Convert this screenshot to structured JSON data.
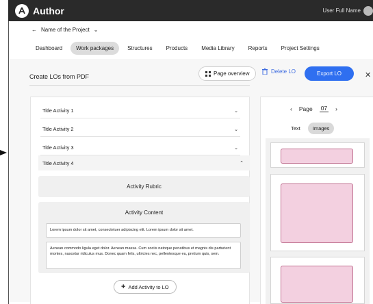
{
  "app": {
    "title": "Author",
    "user_name": "User Full Name"
  },
  "project": {
    "name": "Name of the Project"
  },
  "nav": {
    "tabs": [
      {
        "label": "Dashboard",
        "active": false
      },
      {
        "label": "Work packages",
        "active": true
      },
      {
        "label": "Structures",
        "active": false
      },
      {
        "label": "Products",
        "active": false
      },
      {
        "label": "Media Library",
        "active": false
      },
      {
        "label": "Reports",
        "active": false
      },
      {
        "label": "Project Settings",
        "active": false
      }
    ]
  },
  "header": {
    "title": "Create LOs from PDF",
    "overview_label": "Page overview",
    "delete_label": "Delete LO",
    "export_label": "Export LO"
  },
  "activities": [
    {
      "title": "Title Activity 1",
      "expanded": false
    },
    {
      "title": "Title Activity 2",
      "expanded": false
    },
    {
      "title": "Title Activity 3",
      "expanded": false
    },
    {
      "title": "Title Activity 4",
      "expanded": true
    }
  ],
  "activity_detail": {
    "rubric_label": "Activity Rubric",
    "content_label": "Activity Content",
    "text_1": "Lorem ipsum dolor sit amet, consectetuer adipiscing elit. Lorem ipsum dolor sit amet.",
    "text_2": "Aenean commodo ligula eget dolor. Aenean massa. Cum sociis natoque penatibus et magnis dis parturient montes, nascetur ridiculus mus. Donec quam felis, ultricies nec, pellentesque eu, pretium quis, sem.",
    "add_label": "Add Activity to LO"
  },
  "viewer": {
    "page_label": "Page",
    "page_number": "07",
    "modes": [
      {
        "label": "Text",
        "active": false
      },
      {
        "label": "Images",
        "active": true
      }
    ]
  },
  "colors": {
    "accent": "#2f6ff0",
    "topbar": "#2a2a2a",
    "thumb_fill": "#f3d0e0",
    "thumb_border": "#c07090"
  }
}
